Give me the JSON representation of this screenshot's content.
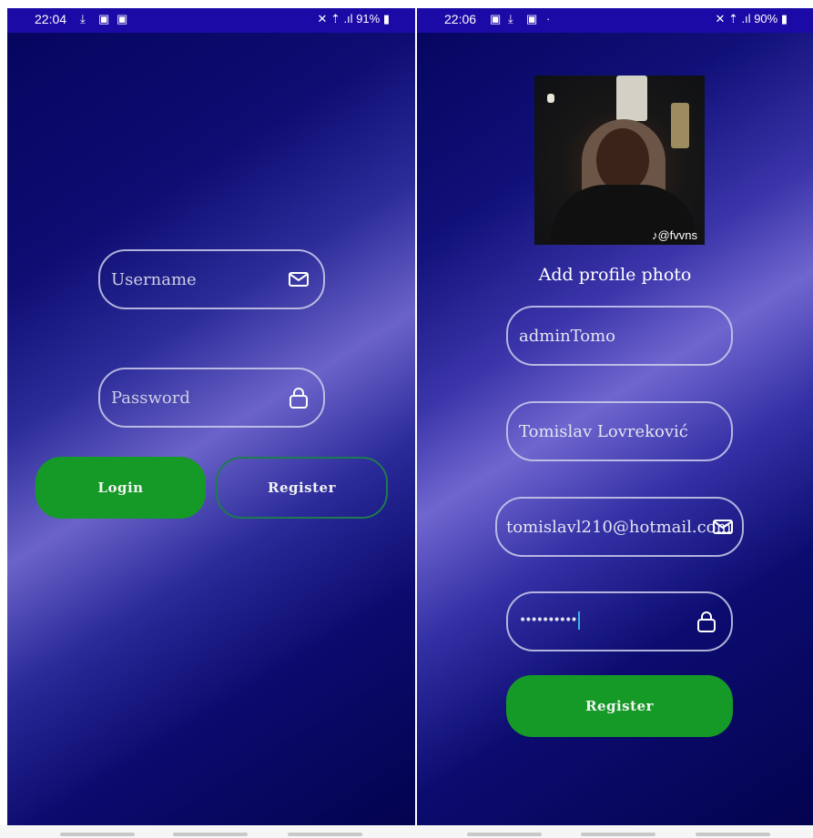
{
  "login_screen": {
    "status_bar": {
      "time": "22:04",
      "notification_icons": [
        "download-icon",
        "calendar-icon",
        "image-icon"
      ],
      "indicators": "✕ ⇡ .ıl",
      "battery": "91%"
    },
    "username_placeholder": "Username",
    "password_placeholder": "Password",
    "login_button": "Login",
    "register_button": "Register"
  },
  "register_screen": {
    "status_bar": {
      "time": "22:06",
      "notification_icons": [
        "image-icon",
        "download-icon",
        "calendar-icon"
      ],
      "dot": "·",
      "indicators": "✕ ⇡ .ıl",
      "battery": "90%"
    },
    "photo_watermark": "@fvvns",
    "add_photo_label": "Add profile photo",
    "username_value": "adminTomo",
    "fullname_value": "Tomislav Lovreković",
    "email_value": "tomislavl210@hotmail.com",
    "password_value": "••••••••••",
    "register_button": "Register"
  },
  "colors": {
    "accent_green": "#169a27",
    "status_bar": "#1c0aa6",
    "background_dark": "#05055e",
    "background_light": "#6b63c9"
  }
}
